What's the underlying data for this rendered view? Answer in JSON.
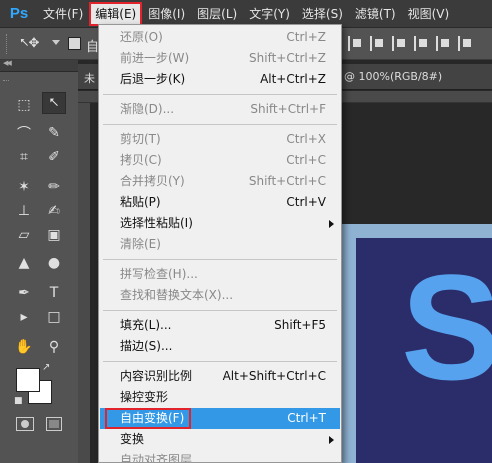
{
  "app": {
    "logo": "Ps"
  },
  "menubar": [
    {
      "label": "文件(F)"
    },
    {
      "label": "编辑(E)",
      "open": true
    },
    {
      "label": "图像(I)"
    },
    {
      "label": "图层(L)"
    },
    {
      "label": "文字(Y)"
    },
    {
      "label": "选择(S)"
    },
    {
      "label": "滤镜(T)"
    },
    {
      "label": "视图(V)"
    }
  ],
  "options_bar": {
    "clipped_text": "自",
    "auto_select_checked": false
  },
  "document": {
    "tab_start": "未",
    "tab_end": "@ 100%(RGB/8#)",
    "art_letter": "S",
    "art_bg": "#2a2d6a",
    "art_letter_color": "#57a2ee"
  },
  "colors": {
    "highlight": "#3399e6",
    "annotation_red": "#e3232b",
    "menu_bg": "#f0f0f0"
  },
  "edit_menu": {
    "items": [
      {
        "label": "还原(O)",
        "shortcut": "Ctrl+Z",
        "disabled": true
      },
      {
        "label": "前进一步(W)",
        "shortcut": "Shift+Ctrl+Z",
        "disabled": true
      },
      {
        "label": "后退一步(K)",
        "shortcut": "Alt+Ctrl+Z",
        "disabled": false
      },
      {
        "separator": true
      },
      {
        "label": "渐隐(D)...",
        "shortcut": "Shift+Ctrl+F",
        "disabled": true
      },
      {
        "separator": true
      },
      {
        "label": "剪切(T)",
        "shortcut": "Ctrl+X",
        "disabled": true
      },
      {
        "label": "拷贝(C)",
        "shortcut": "Ctrl+C",
        "disabled": true
      },
      {
        "label": "合并拷贝(Y)",
        "shortcut": "Shift+Ctrl+C",
        "disabled": true
      },
      {
        "label": "粘贴(P)",
        "shortcut": "Ctrl+V",
        "disabled": false
      },
      {
        "label": "选择性粘贴(I)",
        "shortcut": "",
        "disabled": false,
        "submenu": true
      },
      {
        "label": "清除(E)",
        "shortcut": "",
        "disabled": true
      },
      {
        "separator": true
      },
      {
        "label": "拼写检查(H)...",
        "shortcut": "",
        "disabled": true
      },
      {
        "label": "查找和替换文本(X)...",
        "shortcut": "",
        "disabled": true
      },
      {
        "separator": true
      },
      {
        "label": "填充(L)...",
        "shortcut": "Shift+F5",
        "disabled": false
      },
      {
        "label": "描边(S)...",
        "shortcut": "",
        "disabled": false
      },
      {
        "separator": true
      },
      {
        "label": "内容识别比例",
        "shortcut": "Alt+Shift+Ctrl+C",
        "disabled": false
      },
      {
        "label": "操控变形",
        "shortcut": "",
        "disabled": false
      },
      {
        "label": "自由变换(F)",
        "shortcut": "Ctrl+T",
        "disabled": false,
        "highlighted": true
      },
      {
        "label": "变换",
        "shortcut": "",
        "disabled": false,
        "submenu": true
      },
      {
        "label": "自动对齐图层...",
        "shortcut": "",
        "disabled": true
      }
    ]
  }
}
